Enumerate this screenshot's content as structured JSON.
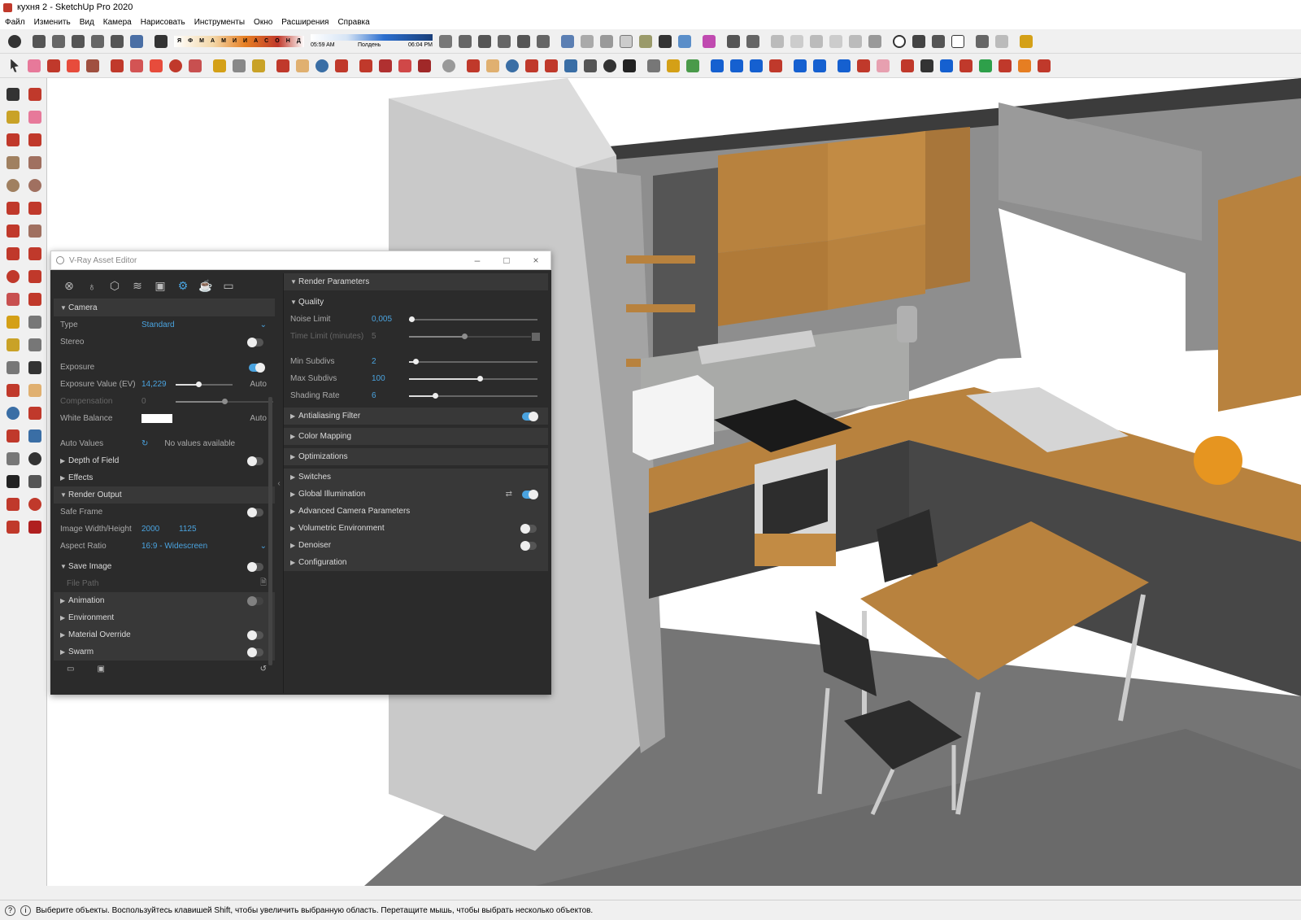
{
  "window": {
    "title": "кухня 2 - SketchUp Pro 2020"
  },
  "menu": [
    "Файл",
    "Изменить",
    "Вид",
    "Камера",
    "Нарисовать",
    "Инструменты",
    "Окно",
    "Расширения",
    "Справка"
  ],
  "shadow": {
    "months": [
      "Я",
      "Ф",
      "М",
      "А",
      "М",
      "И",
      "И",
      "А",
      "С",
      "О",
      "Н",
      "Д"
    ],
    "time_start": "05:59 AM",
    "time_mid": "Полдень",
    "time_end": "06:04 PM"
  },
  "status": {
    "message": "Выберите объекты. Воспользуйтесь клавишей Shift, чтобы увеличить выбранную область. Перетащите мышь, чтобы выбрать несколько объектов."
  },
  "vray": {
    "title": "V-Ray Asset Editor",
    "camera": {
      "section": "Camera",
      "type_label": "Type",
      "type_value": "Standard",
      "stereo_label": "Stereo",
      "exposure_label": "Exposure",
      "ev_label": "Exposure Value (EV)",
      "ev_value": "14,229",
      "ev_auto": "Auto",
      "comp_label": "Compensation",
      "comp_value": "0",
      "wb_label": "White Balance",
      "wb_auto": "Auto",
      "auto_label": "Auto Values",
      "auto_value": "No values available",
      "dof_label": "Depth of Field",
      "effects_label": "Effects"
    },
    "render_output": {
      "section": "Render Output",
      "safe_frame": "Safe Frame",
      "wh_label": "Image Width/Height",
      "width": "2000",
      "height": "1125",
      "aspect_label": "Aspect Ratio",
      "aspect_value": "16:9 - Widescreen",
      "save_image": "Save Image",
      "file_path": "File Path"
    },
    "more_sections": [
      "Animation",
      "Environment",
      "Material Override",
      "Swarm"
    ],
    "render_params": {
      "section": "Render Parameters",
      "quality": "Quality",
      "noise_label": "Noise Limit",
      "noise_value": "0,005",
      "time_label": "Time Limit (minutes)",
      "time_value": "5",
      "min_label": "Min Subdivs",
      "min_value": "2",
      "max_label": "Max Subdivs",
      "max_value": "100",
      "shading_label": "Shading Rate",
      "shading_value": "6",
      "sections": [
        "Antialiasing Filter",
        "Color Mapping",
        "Optimizations",
        "Switches",
        "Global Illumination",
        "Advanced Camera Parameters",
        "Volumetric Environment",
        "Denoiser",
        "Configuration"
      ]
    },
    "sliders": {
      "ev": 0.4,
      "comp": 0.5,
      "noise": 0.02,
      "time": 0.45,
      "min": 0.05,
      "max": 0.55,
      "shading": 0.2
    }
  }
}
